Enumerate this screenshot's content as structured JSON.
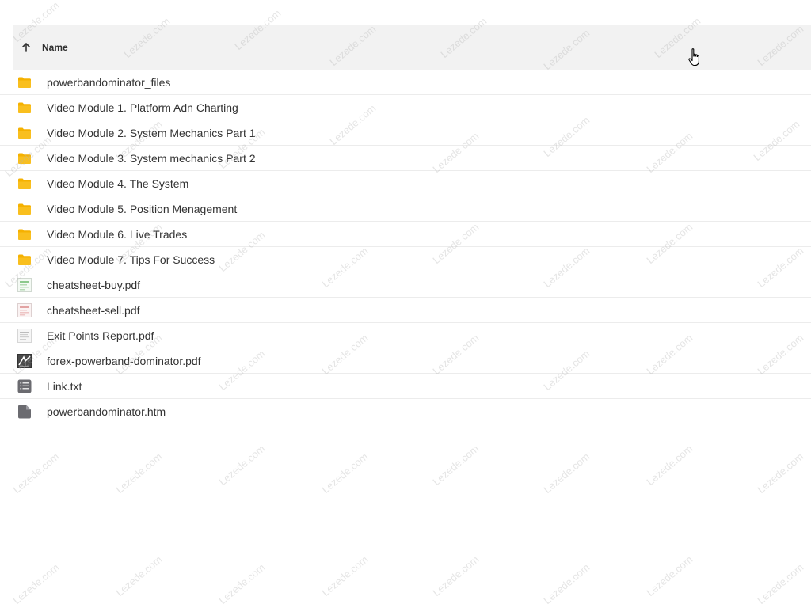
{
  "header": {
    "sort_column_label": "Name",
    "sort_direction": "ascending"
  },
  "files": [
    {
      "name": "powerbandominator_files",
      "type": "folder"
    },
    {
      "name": "Video Module 1. Platform Adn Charting",
      "type": "folder"
    },
    {
      "name": "Video Module 2. System Mechanics Part 1",
      "type": "folder"
    },
    {
      "name": "Video Module 3. System mechanics Part 2",
      "type": "folder"
    },
    {
      "name": "Video Module 4. The System",
      "type": "folder"
    },
    {
      "name": "Video Module 5. Position Menagement",
      "type": "folder"
    },
    {
      "name": "Video Module 6. Live Trades",
      "type": "folder"
    },
    {
      "name": "Video Module 7. Tips For Success",
      "type": "folder"
    },
    {
      "name": "cheatsheet-buy.pdf",
      "type": "pdf-thumb-green"
    },
    {
      "name": "cheatsheet-sell.pdf",
      "type": "pdf-thumb-red"
    },
    {
      "name": "Exit Points Report.pdf",
      "type": "pdf-thumb-gray"
    },
    {
      "name": "forex-powerband-dominator.pdf",
      "type": "pdf-thumb-dark"
    },
    {
      "name": "Link.txt",
      "type": "text"
    },
    {
      "name": "powerbandominator.htm",
      "type": "file"
    }
  ],
  "watermark": {
    "text": "Lezede.com"
  },
  "colors": {
    "folder": "#f5b100",
    "header_bg": "#f2f2f2",
    "row_border": "#ececec",
    "text": "#333333",
    "doc_icon": "#6b6b70"
  }
}
